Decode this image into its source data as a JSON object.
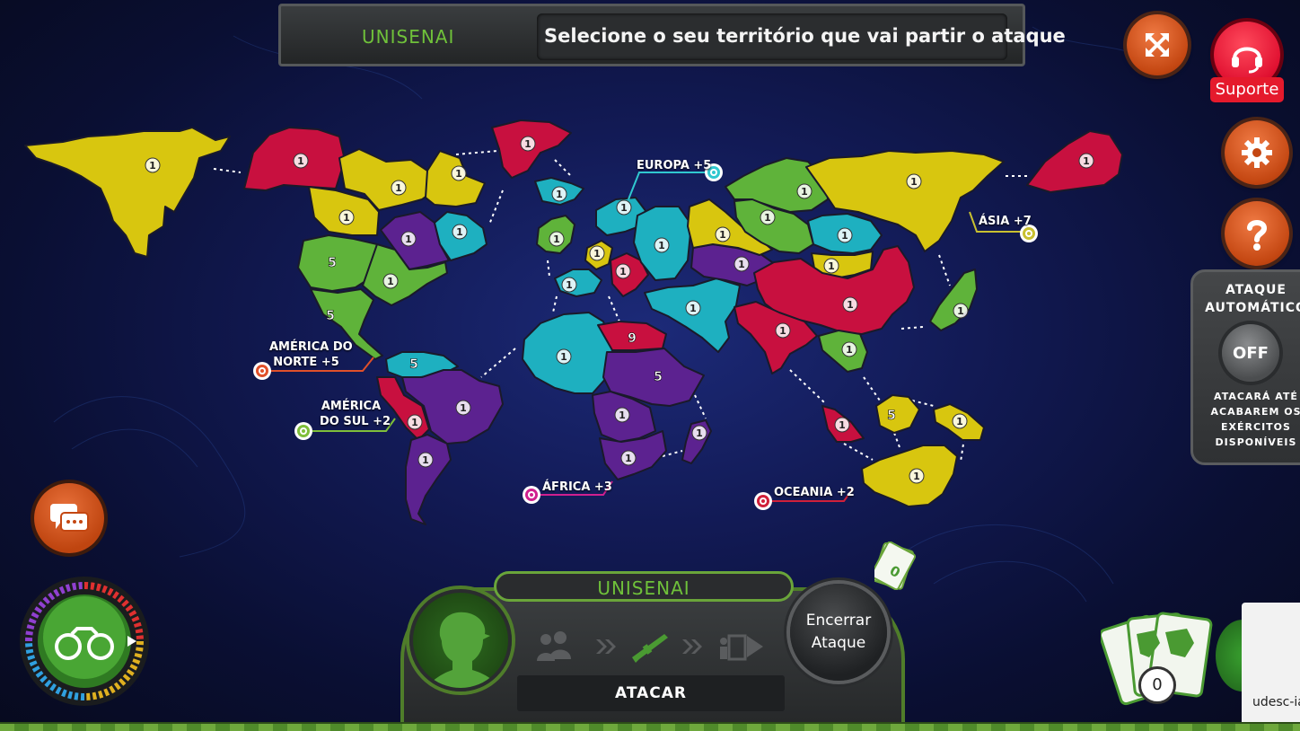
{
  "header": {
    "player_name": "UNISENAI",
    "instruction": "Selecione o seu território que vai partir o ataque"
  },
  "top_right": {
    "fullscreen_icon": "expand-arrows-icon",
    "support_label": "Suporte",
    "settings_icon": "gear-icon",
    "help_icon": "question-icon"
  },
  "auto_attack": {
    "title_line1": "ATAQUE",
    "title_line2": "AUTOMÁTICO",
    "toggle_label": "OFF",
    "desc_line1": "ATACARÁ ATÉ",
    "desc_line2": "ACABAREM OS",
    "desc_line3": "EXÉRCITOS",
    "desc_line4": "DISPONÍVEIS"
  },
  "continents": {
    "north_america_line1": "AMÉRICA DO",
    "north_america_line2": "NORTE +5",
    "south_america_line1": "AMÉRICA",
    "south_america_line2": "DO SUL +2",
    "europe": "EUROPA +5",
    "africa": "ÁFRICA +3",
    "asia": "ÁSIA +7",
    "oceania": "OCEANIA +2"
  },
  "colors": {
    "yellow": "#d8c60f",
    "red": "#c8103f",
    "purple": "#5c2290",
    "cyan": "#1eb0c0",
    "green": "#5fb33a",
    "north_america_marker": "#e0502a",
    "south_america_marker": "#7fbf3a",
    "europe_marker": "#30c8d0",
    "africa_marker": "#d0208f",
    "asia_marker": "#c8c030",
    "oceania_marker": "#d0203a"
  },
  "territories": [
    {
      "id": "alaska",
      "color": "yellow",
      "troops": "1"
    },
    {
      "id": "mackenzie",
      "color": "red",
      "troops": "1"
    },
    {
      "id": "groenlandia",
      "color": "red",
      "troops": "1"
    },
    {
      "id": "vancouver",
      "color": "yellow",
      "troops": "1"
    },
    {
      "id": "ottawa",
      "color": "yellow",
      "troops": "1"
    },
    {
      "id": "labrador",
      "color": "yellow",
      "troops": "1"
    },
    {
      "id": "quebec",
      "color": "purple",
      "troops": "1"
    },
    {
      "id": "nova-york",
      "color": "cyan",
      "troops": "1"
    },
    {
      "id": "california",
      "color": "green",
      "troops": "5"
    },
    {
      "id": "nova-york-2",
      "color": "green",
      "troops": "1"
    },
    {
      "id": "mexico",
      "color": "green",
      "troops": "5"
    },
    {
      "id": "colombia",
      "color": "cyan",
      "troops": "5"
    },
    {
      "id": "peru",
      "color": "red",
      "troops": "1"
    },
    {
      "id": "brasil",
      "color": "purple",
      "troops": "1"
    },
    {
      "id": "argentina",
      "color": "purple",
      "troops": "1"
    },
    {
      "id": "islandia",
      "color": "cyan",
      "troops": "1"
    },
    {
      "id": "inglaterra",
      "color": "green",
      "troops": "1"
    },
    {
      "id": "suecia",
      "color": "cyan",
      "troops": "1"
    },
    {
      "id": "alemanha",
      "color": "yellow",
      "troops": "1"
    },
    {
      "id": "polonia",
      "color": "red",
      "troops": "1"
    },
    {
      "id": "moscou",
      "color": "cyan",
      "troops": "1"
    },
    {
      "id": "portugal",
      "color": "cyan",
      "troops": "1"
    },
    {
      "id": "argelia",
      "color": "cyan",
      "troops": "1"
    },
    {
      "id": "egito",
      "color": "red",
      "troops": "9"
    },
    {
      "id": "sudao",
      "color": "purple",
      "troops": "5"
    },
    {
      "id": "congo",
      "color": "purple",
      "troops": "1"
    },
    {
      "id": "africa-do-sul",
      "color": "purple",
      "troops": "1"
    },
    {
      "id": "madagascar",
      "color": "purple",
      "troops": "1"
    },
    {
      "id": "oriente-medio",
      "color": "cyan",
      "troops": "1"
    },
    {
      "id": "aral",
      "color": "purple",
      "troops": "1"
    },
    {
      "id": "omsk",
      "color": "yellow",
      "troops": "1"
    },
    {
      "id": "dudinka",
      "color": "green",
      "troops": "1"
    },
    {
      "id": "siberia",
      "color": "green",
      "troops": "1"
    },
    {
      "id": "tchita",
      "color": "cyan",
      "troops": "1"
    },
    {
      "id": "mongolia",
      "color": "yellow",
      "troops": "1"
    },
    {
      "id": "vladivostok",
      "color": "red",
      "troops": "1"
    },
    {
      "id": "vladivostok-2",
      "color": "yellow",
      "troops": "1"
    },
    {
      "id": "china",
      "color": "red",
      "troops": "1"
    },
    {
      "id": "india",
      "color": "red",
      "troops": "1"
    },
    {
      "id": "vietna",
      "color": "green",
      "troops": "1"
    },
    {
      "id": "japao",
      "color": "green",
      "troops": "1"
    },
    {
      "id": "sumatra",
      "color": "red",
      "troops": "1"
    },
    {
      "id": "borneo",
      "color": "yellow",
      "troops": "5"
    },
    {
      "id": "nova-guine",
      "color": "yellow",
      "troops": "1"
    },
    {
      "id": "australia",
      "color": "yellow",
      "troops": "1"
    }
  ],
  "action_panel": {
    "player_name": "UNISENAI",
    "phase_label": "ATACAR",
    "end_button": "Encerrar Ataque",
    "step_icons": [
      "troops-icon",
      "chevron-icon",
      "rifle-icon",
      "chevron-icon",
      "move-icon"
    ]
  },
  "cards": {
    "count": "0",
    "money_card_value": "0"
  },
  "overlay_text": "udesc-ia"
}
